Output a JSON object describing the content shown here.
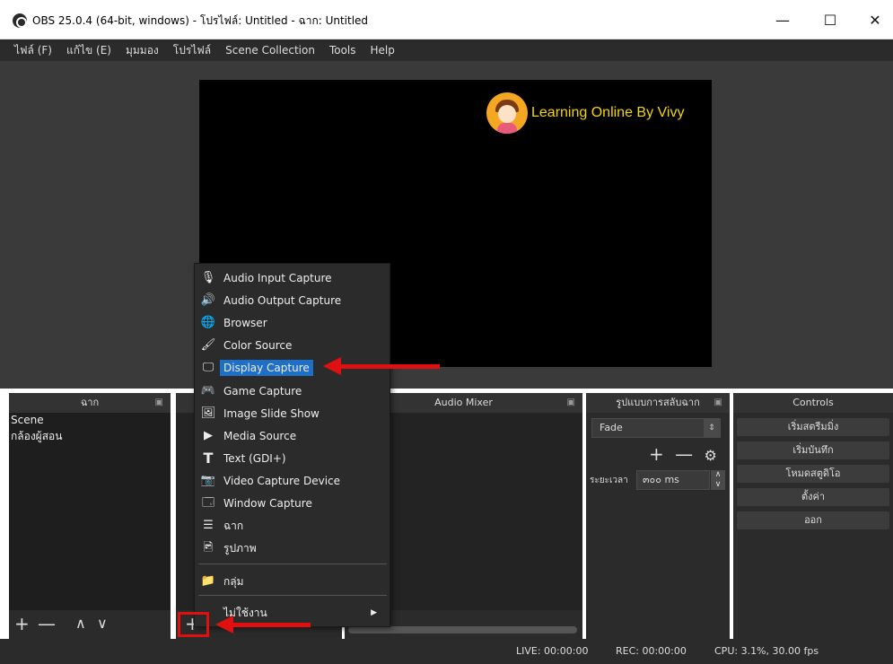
{
  "window": {
    "title": "OBS 25.0.4 (64-bit, windows) - โปรไฟล์: Untitled - ฉาก: Untitled",
    "minimize": "—",
    "maximize": "☐",
    "close": "✕"
  },
  "menubar": [
    "ไฟล์ (F)",
    "แก้ไข (E)",
    "มุมมอง",
    "โปรไฟล์",
    "Scene Collection",
    "Tools",
    "Help"
  ],
  "preview": {
    "overlay_text": "Learning Online By Vivy"
  },
  "docks": {
    "scenes": {
      "title": "ฉาก",
      "items": [
        "Scene",
        "กล้องผู้สอน"
      ]
    },
    "sources": {
      "title": ""
    },
    "mixer": {
      "title": "Audio Mixer"
    },
    "transitions": {
      "title": "รูปแบบการสลับฉาก",
      "selected": "Fade",
      "duration_label": "ระยะเวลา",
      "duration_value": "๓๐๐ ms"
    },
    "controls": {
      "title": "Controls",
      "buttons": [
        "เริ่มสตรีมมิ่ง",
        "เริ่มบันทึก",
        "โหมดสตูดิโอ",
        "ตั้งค่า",
        "ออก"
      ]
    }
  },
  "context_menu": {
    "items": [
      "Audio Input Capture",
      "Audio Output Capture",
      "Browser",
      "Color Source",
      "Display Capture",
      "Game Capture",
      "Image Slide Show",
      "Media Source",
      "Text (GDI+)",
      "Video Capture Device",
      "Window Capture",
      "ฉาก",
      "รูปภาพ",
      "กลุ่ม",
      "ไม่ใช้งาน"
    ],
    "highlighted": "Display Capture"
  },
  "statusbar": {
    "live": "LIVE: 00:00:00",
    "rec": "REC: 00:00:00",
    "cpu": "CPU: 3.1%, 30.00 fps"
  },
  "colors": {
    "highlight": "#1e6fc8",
    "annotation": "#e01010",
    "overlay_text": "#f5d600"
  }
}
